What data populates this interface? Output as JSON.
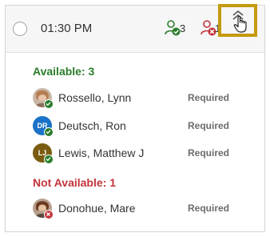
{
  "header": {
    "time": "01:30 PM",
    "available_count": "3",
    "unavailable_count": "1"
  },
  "available": {
    "heading": "Available: 3",
    "people": [
      {
        "name": "Rossello, Lynn",
        "requirement": "Required",
        "avatar": "photo"
      },
      {
        "name": "Deutsch, Ron",
        "requirement": "Required",
        "avatar": "initials",
        "initials": "DR",
        "color": "#1a73c8"
      },
      {
        "name": "Lewis, Matthew J",
        "requirement": "Required",
        "avatar": "initials",
        "initials": "LJ",
        "color": "#7a5c10"
      }
    ]
  },
  "unavailable": {
    "heading": "Not Available: 1",
    "people": [
      {
        "name": "Donohue, Mare",
        "requirement": "Required",
        "avatar": "photo"
      }
    ]
  },
  "colors": {
    "available": "#2b7d2b",
    "unavailable": "#c4333b",
    "highlight": "#c49a0f"
  }
}
